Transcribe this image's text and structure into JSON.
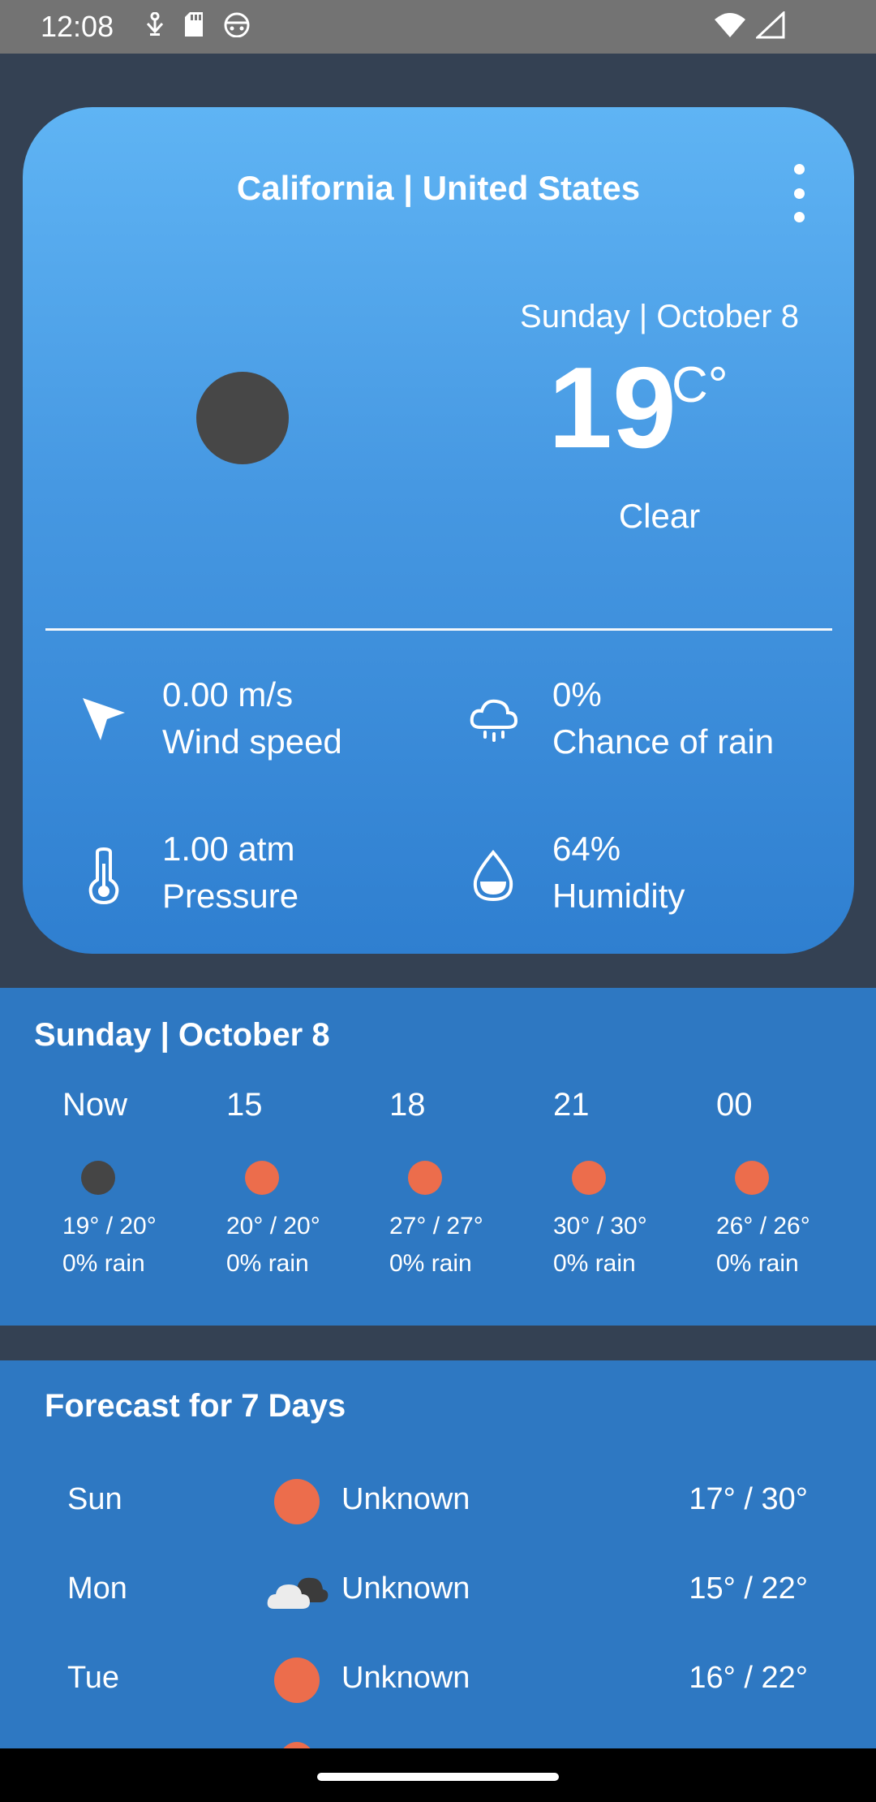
{
  "status_bar": {
    "time": "12:08"
  },
  "header": {
    "location": "California | United States"
  },
  "current": {
    "date": "Sunday | October 8",
    "temp": "19",
    "unit": "C°",
    "condition": "Clear",
    "icon": "dark-circle-icon"
  },
  "stats": {
    "wind": {
      "value": "0.00 m/s",
      "label": "Wind speed",
      "icon": "navigation-arrow-icon"
    },
    "rain": {
      "value": "0%",
      "label": "Chance of rain",
      "icon": "rain-cloud-icon"
    },
    "pressure": {
      "value": "1.00 atm",
      "label": "Pressure",
      "icon": "thermometer-icon"
    },
    "humidity": {
      "value": "64%",
      "label": "Humidity",
      "icon": "water-drop-icon"
    }
  },
  "hourly": {
    "title": "Sunday | October 8",
    "items": [
      {
        "time": "Now",
        "temp": "19° / 20°",
        "rain": "0% rain",
        "icon_color": "#454545"
      },
      {
        "time": "15",
        "temp": "20° / 20°",
        "rain": "0% rain",
        "icon_color": "#ec6d4c"
      },
      {
        "time": "18",
        "temp": "27° / 27°",
        "rain": "0% rain",
        "icon_color": "#ec6d4c"
      },
      {
        "time": "21",
        "temp": "30° / 30°",
        "rain": "0% rain",
        "icon_color": "#ec6d4c"
      },
      {
        "time": "00",
        "temp": "26° / 26°",
        "rain": "0% rain",
        "icon_color": "#ec6d4c"
      }
    ]
  },
  "weekly": {
    "title": "Forecast for 7 Days",
    "days": [
      {
        "day": "Sun",
        "condition": "Unknown",
        "temp": "17° / 30°",
        "icon": "sun-icon"
      },
      {
        "day": "Mon",
        "condition": "Unknown",
        "temp": "15° / 22°",
        "icon": "cloud-icon"
      },
      {
        "day": "Tue",
        "condition": "Unknown",
        "temp": "16° / 22°",
        "icon": "sun-icon"
      }
    ]
  },
  "colors": {
    "background": "#344153",
    "card_top": "#5fb4f4",
    "card_bottom": "#2f7fd0",
    "panel": "#2e78c2",
    "sun": "#ec6d4c",
    "dark_icon": "#454545"
  }
}
